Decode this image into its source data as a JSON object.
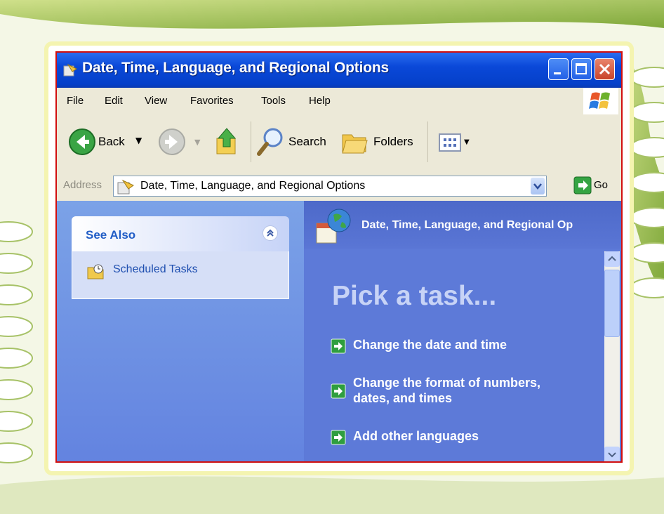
{
  "window": {
    "title": "Date, Time, Language, and Regional Options"
  },
  "menubar": {
    "items": [
      "File",
      "Edit",
      "View",
      "Favorites",
      "Tools",
      "Help"
    ]
  },
  "toolbar": {
    "back_label": "Back",
    "search_label": "Search",
    "folders_label": "Folders"
  },
  "addressbar": {
    "label": "Address",
    "value": "Date, Time, Language, and Regional Options",
    "go_label": "Go"
  },
  "see_also": {
    "title": "See Also",
    "items": [
      "Scheduled Tasks"
    ]
  },
  "category": {
    "title": "Date, Time, Language, and Regional Op",
    "heading": "Pick a task...",
    "tasks": [
      "Change the date and time",
      "Change the format of numbers,",
      "dates, and times",
      "Add other languages"
    ]
  },
  "colors": {
    "titlebar": "#0a48d8",
    "left_pane": "#6f93e4",
    "right_pane": "#5d7ad8",
    "task_arrow": "#2f9e3f",
    "frame_highlight": "#d10f0f"
  }
}
